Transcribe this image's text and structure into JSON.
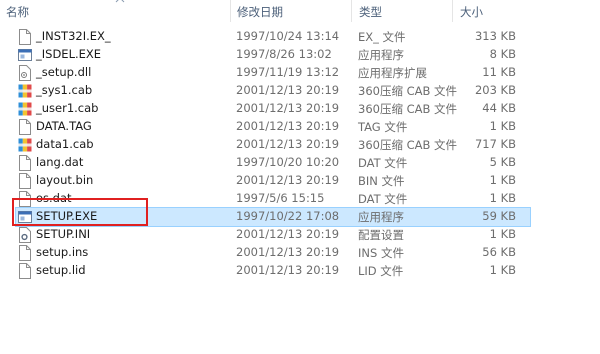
{
  "header": {
    "name": "名称",
    "modified": "修改日期",
    "type": "类型",
    "size": "大小"
  },
  "files": [
    {
      "name": "_INST32I.EX_",
      "modified": "1997/10/24 13:14",
      "type": "EX_ 文件",
      "size": "313 KB",
      "icon": "generic-file-icon"
    },
    {
      "name": "_ISDEL.EXE",
      "modified": "1997/8/26 13:02",
      "type": "应用程序",
      "size": "8 KB",
      "icon": "application-icon"
    },
    {
      "name": "_setup.dll",
      "modified": "1997/11/19 13:12",
      "type": "应用程序扩展",
      "size": "11 KB",
      "icon": "dll-icon"
    },
    {
      "name": "_sys1.cab",
      "modified": "2001/12/13 20:19",
      "type": "360压缩 CAB 文件",
      "size": "203 KB",
      "icon": "archive-icon"
    },
    {
      "name": "_user1.cab",
      "modified": "2001/12/13 20:19",
      "type": "360压缩 CAB 文件",
      "size": "44 KB",
      "icon": "archive-icon"
    },
    {
      "name": "DATA.TAG",
      "modified": "2001/12/13 20:19",
      "type": "TAG 文件",
      "size": "1 KB",
      "icon": "generic-file-icon"
    },
    {
      "name": "data1.cab",
      "modified": "2001/12/13 20:19",
      "type": "360压缩 CAB 文件",
      "size": "717 KB",
      "icon": "archive-icon"
    },
    {
      "name": "lang.dat",
      "modified": "1997/10/20 10:20",
      "type": "DAT 文件",
      "size": "5 KB",
      "icon": "generic-file-icon"
    },
    {
      "name": "layout.bin",
      "modified": "2001/12/13 20:19",
      "type": "BIN 文件",
      "size": "1 KB",
      "icon": "generic-file-icon"
    },
    {
      "name": "os.dat",
      "modified": "1997/5/6 15:15",
      "type": "DAT 文件",
      "size": "1 KB",
      "icon": "generic-file-icon"
    },
    {
      "name": "SETUP.EXE",
      "modified": "1997/10/22 17:08",
      "type": "应用程序",
      "size": "59 KB",
      "icon": "application-icon",
      "selected": true
    },
    {
      "name": "SETUP.INI",
      "modified": "2001/12/13 20:19",
      "type": "配置设置",
      "size": "1 KB",
      "icon": "settings-file-icon"
    },
    {
      "name": "setup.ins",
      "modified": "2001/12/13 20:19",
      "type": "INS 文件",
      "size": "56 KB",
      "icon": "generic-file-icon"
    },
    {
      "name": "setup.lid",
      "modified": "2001/12/13 20:19",
      "type": "LID 文件",
      "size": "1 KB",
      "icon": "generic-file-icon"
    }
  ],
  "colors": {
    "selection_bg": "#cce8ff",
    "annotation_border": "#e02020",
    "header_text": "#4c607a"
  }
}
